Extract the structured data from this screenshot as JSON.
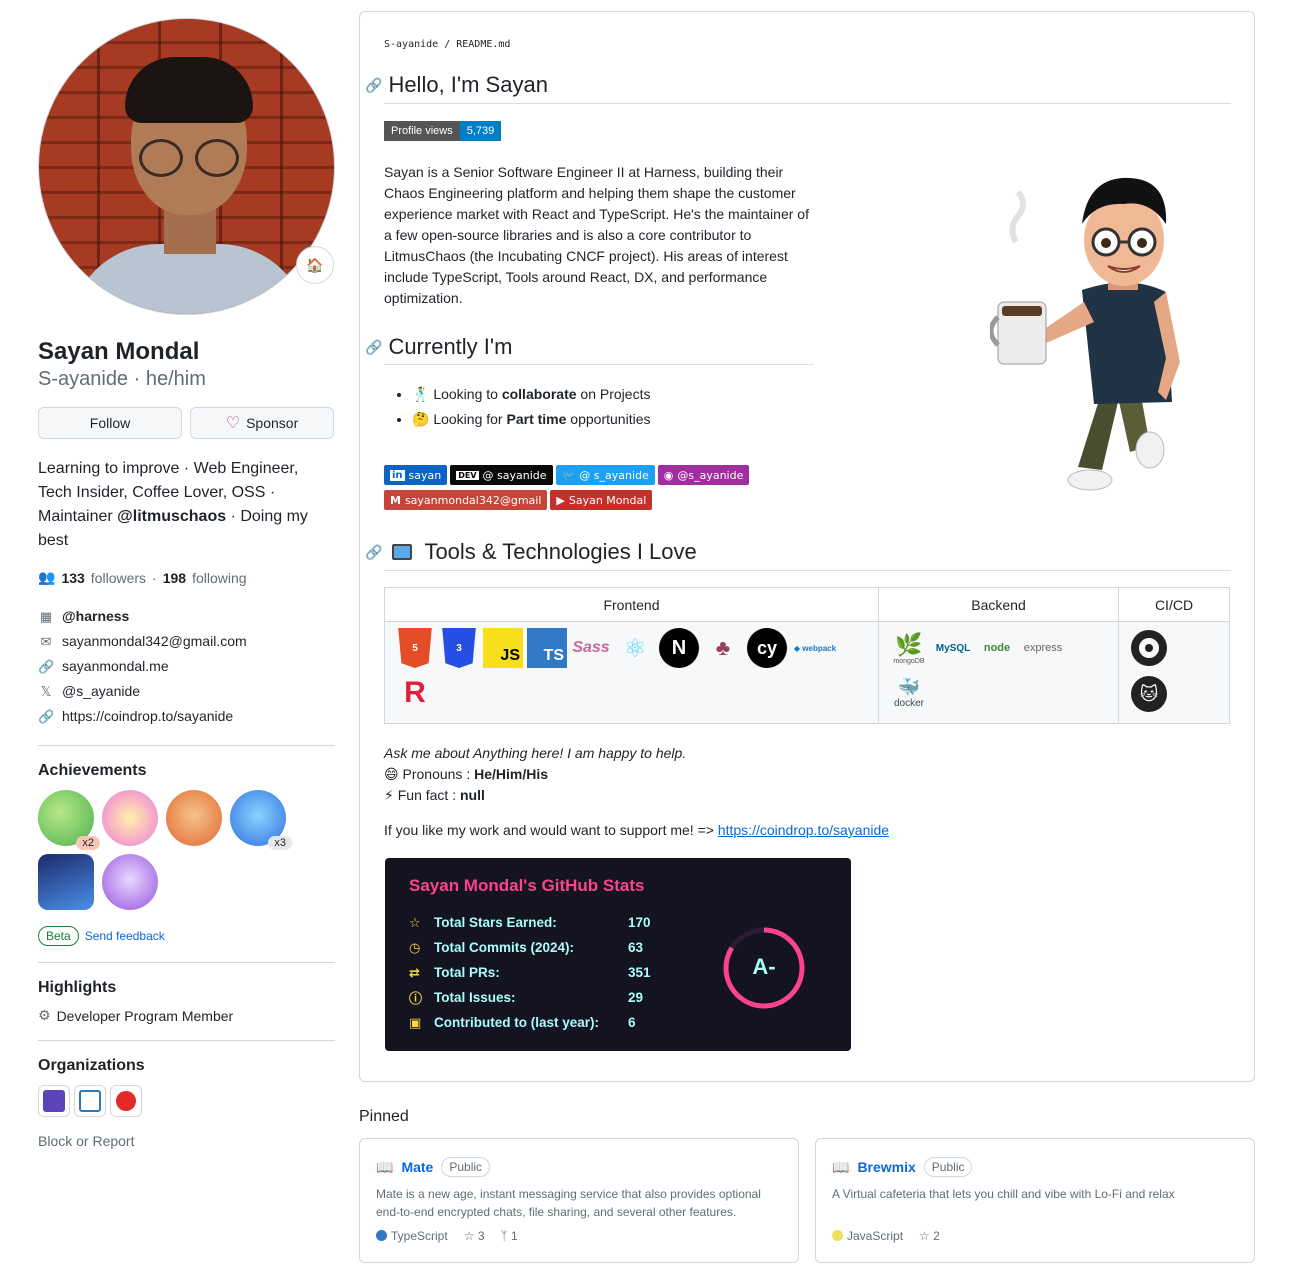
{
  "profile": {
    "name": "Sayan Mondal",
    "login": "S-ayanide · he/him",
    "follow_label": "Follow",
    "sponsor_label": "Sponsor",
    "bio_1": "Learning to improve · Web Engineer, Tech Insider, Coffee Lover, OSS · Maintainer ",
    "bio_org": "@litmuschaos",
    "bio_2": " · Doing my best",
    "followers_count": "133",
    "followers_label": "followers",
    "sep": "·",
    "following_count": "198",
    "following_label": "following",
    "company": "@harness",
    "email": "sayanmondal342@gmail.com",
    "website": "sayanmondal.me",
    "twitter": "@s_ayanide",
    "social_link": "https://coindrop.to/sayanide",
    "achievements_title": "Achievements",
    "achievement_counts": [
      "x2",
      "x3"
    ],
    "beta_label": "Beta",
    "feedback_label": "Send feedback",
    "highlights_title": "Highlights",
    "highlight_item": "Developer Program Member",
    "orgs_title": "Organizations",
    "block_label": "Block or Report"
  },
  "readme": {
    "breadcrumb": "S-ayanide / README.md",
    "hello": "Hello, I'm Sayan",
    "pv_label": "Profile views",
    "pv_value": "5,739",
    "about": "Sayan is a Senior Software Engineer II at Harness, building their Chaos Engineering platform and helping them shape the customer experience market with React and TypeScript. He's the maintainer of a few open-source libraries and is also a core contributor to LitmusChaos (the Incubating CNCF project). His areas of interest include TypeScript, Tools around React, DX, and performance optimization.",
    "currently": "Currently I'm",
    "item1_pre": "Looking to ",
    "item1_b": "collaborate",
    "item1_post": " on Projects",
    "item2_pre": "Looking for ",
    "item2_b": "Part time",
    "item2_post": " opportunities",
    "badges": [
      {
        "label": "sayan",
        "color": "#0a66c2"
      },
      {
        "label": "@ sayanide",
        "color": "#0a0a0a"
      },
      {
        "label": "@ s_ayanide",
        "color": "#1ca0f2"
      },
      {
        "label": "@s_ayanide",
        "color": "#a12ea0"
      },
      {
        "label": "sayanmondal342@gmail",
        "color": "#c4463a"
      },
      {
        "label": "Sayan Mondal",
        "color": "#c4302b"
      }
    ],
    "tools_title": "Tools & Technologies I Love",
    "col_frontend": "Frontend",
    "col_backend": "Backend",
    "col_cicd": "CI/CD",
    "ask": "Ask me about Anything here! I am happy to help.",
    "pronouns_label": "Pronouns : ",
    "pronouns": "He/Him/His",
    "fun_label": "Fun fact : ",
    "fun": "null",
    "support_text": "If you like my work and would want to support me! => ",
    "support_link": "https://coindrop.to/sayanide",
    "stats_title": "Sayan Mondal's GitHub Stats",
    "stats": [
      {
        "label": "Total Stars Earned:",
        "value": "170",
        "icon": "star-icon"
      },
      {
        "label": "Total Commits (2024):",
        "value": "63",
        "icon": "history-icon"
      },
      {
        "label": "Total PRs:",
        "value": "351",
        "icon": "pr-icon"
      },
      {
        "label": "Total Issues:",
        "value": "29",
        "icon": "issue-icon"
      },
      {
        "label": "Contributed to (last year):",
        "value": "6",
        "icon": "repo-icon"
      }
    ],
    "grade": "A-"
  },
  "pinned": {
    "title": "Pinned",
    "repos": [
      {
        "name": "Mate",
        "visibility": "Public",
        "desc": "Mate is a new age, instant messaging service that also provides optional end-to-end encrypted chats, file sharing, and several other features.",
        "lang": "TypeScript",
        "lang_color": "#3178c6",
        "stars": "3",
        "forks": "1"
      },
      {
        "name": "Brewmix",
        "visibility": "Public",
        "desc": "A Virtual cafeteria that lets you chill and vibe with Lo-Fi and relax",
        "lang": "JavaScript",
        "lang_color": "#f1e05a",
        "stars": "2"
      }
    ]
  },
  "colors": {
    "accent": "#0969da",
    "stats_bg": "#141321",
    "stats_title": "#fe428e",
    "stats_text": "#a9fef7"
  }
}
